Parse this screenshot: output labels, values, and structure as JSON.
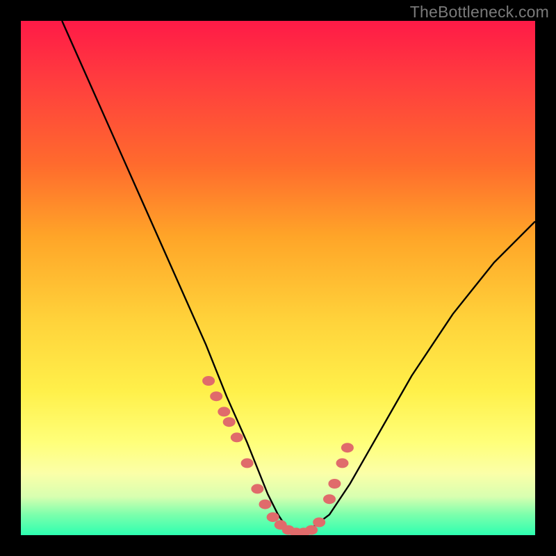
{
  "watermark": "TheBottleneck.com",
  "chart_data": {
    "type": "line",
    "title": "",
    "xlabel": "",
    "ylabel": "",
    "xlim": [
      0,
      100
    ],
    "ylim": [
      0,
      100
    ],
    "series": [
      {
        "name": "bottleneck-curve",
        "x": [
          8,
          12,
          16,
          20,
          24,
          28,
          32,
          36,
          40,
          44,
          48,
          50,
          52,
          54,
          56,
          60,
          64,
          68,
          72,
          76,
          80,
          84,
          88,
          92,
          96,
          100
        ],
        "y": [
          100,
          91,
          82,
          73,
          64,
          55,
          46,
          37,
          27,
          18,
          8,
          4,
          1,
          0,
          1,
          4,
          10,
          17,
          24,
          31,
          37,
          43,
          48,
          53,
          57,
          61
        ]
      }
    ],
    "markers": {
      "name": "highlight-dots",
      "color": "#e06b6b",
      "x": [
        36.5,
        38,
        39.5,
        40.5,
        42,
        44,
        46,
        47.5,
        49,
        50.5,
        52,
        53.5,
        55,
        56.5,
        58,
        60,
        61,
        62.5,
        63.5
      ],
      "y": [
        30,
        27,
        24,
        22,
        19,
        14,
        9,
        6,
        3.5,
        2,
        1,
        0.5,
        0.5,
        1,
        2.5,
        7,
        10,
        14,
        17
      ]
    }
  }
}
